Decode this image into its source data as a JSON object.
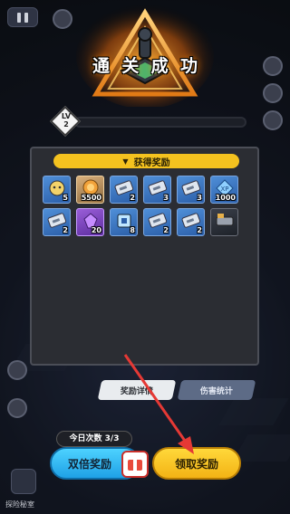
{
  "screen": {
    "title_chars": [
      "通",
      "关",
      "成",
      "功"
    ]
  },
  "level": {
    "label": "LV",
    "value": "2",
    "progress": 0.0
  },
  "panel": {
    "header": "获得奖励",
    "rewards": [
      {
        "count": "5",
        "quality": "blue",
        "icon": "face-badge-icon"
      },
      {
        "count": "5500",
        "quality": "gold",
        "icon": "coin-pile-icon"
      },
      {
        "count": "2",
        "quality": "blue",
        "icon": "weapon-card-icon"
      },
      {
        "count": "3",
        "quality": "blue",
        "icon": "weapon-card-icon"
      },
      {
        "count": "3",
        "quality": "blue",
        "icon": "weapon-card-icon"
      },
      {
        "count": "1000",
        "quality": "blue",
        "icon": "xp-crystal-icon"
      },
      {
        "count": "2",
        "quality": "blue",
        "icon": "weapon-card-icon"
      },
      {
        "count": "20",
        "quality": "purple",
        "icon": "purple-gem-icon"
      },
      {
        "count": "8",
        "quality": "blue",
        "icon": "chip-icon"
      },
      {
        "count": "2",
        "quality": "blue",
        "icon": "weapon-card-icon"
      },
      {
        "count": "2",
        "quality": "blue",
        "icon": "weapon-card-icon"
      },
      {
        "count": "",
        "quality": "dark",
        "icon": "gear-part-icon"
      }
    ]
  },
  "tabs": [
    {
      "label": "奖励详情",
      "active": true
    },
    {
      "label": "伤害统计",
      "active": false
    }
  ],
  "bottom": {
    "count_label": "今日次数 3/3",
    "double_button": "双倍奖励",
    "claim_button": "领取奖励",
    "left_label": "探险秘室"
  },
  "colors": {
    "accent_yellow": "#f4c21f",
    "double_blue": "#33bdf5",
    "arrow_red": "#e53935"
  }
}
